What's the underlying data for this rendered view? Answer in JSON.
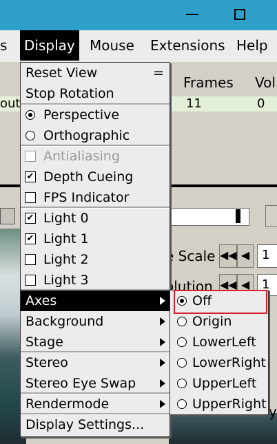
{
  "window": {
    "title": "",
    "minimize_icon": "minimize-icon",
    "maximize_icon": "maximize-icon"
  },
  "menubar": {
    "items": [
      {
        "label": "s"
      },
      {
        "label": "Display"
      },
      {
        "label": "Mouse"
      },
      {
        "label": "Extensions"
      },
      {
        "label": "Help"
      }
    ]
  },
  "background": {
    "columns": {
      "frames": "Frames",
      "vol": "Vol"
    },
    "row": {
      "name": "out.p",
      "frames": "11",
      "vol": "0"
    },
    "scale_label": "e Scale",
    "scale_value": "1",
    "resolution_label": "olution",
    "resolution_value": "1",
    "trailing_char": "y"
  },
  "display_menu": {
    "reset_view": "Reset View",
    "reset_view_shortcut": "=",
    "stop_rotation": "Stop Rotation",
    "perspective": "Perspective",
    "orthographic": "Orthographic",
    "antialiasing": "Antialiasing",
    "depth_cueing": "Depth Cueing",
    "fps_indicator": "FPS Indicator",
    "light0": "Light 0",
    "light1": "Light 1",
    "light2": "Light 2",
    "light3": "Light 3",
    "axes": "Axes",
    "background": "Background",
    "stage": "Stage",
    "stereo": "Stereo",
    "stereo_eye_swap": "Stereo Eye Swap",
    "rendermode": "Rendermode",
    "display_settings": "Display Settings...",
    "checkmark": "✔"
  },
  "axes_menu": {
    "off": "Off",
    "origin": "Origin",
    "lowerleft": "LowerLeft",
    "lowerright": "LowerRight",
    "upperleft": "UpperLeft",
    "upperright": "UpperRight"
  }
}
